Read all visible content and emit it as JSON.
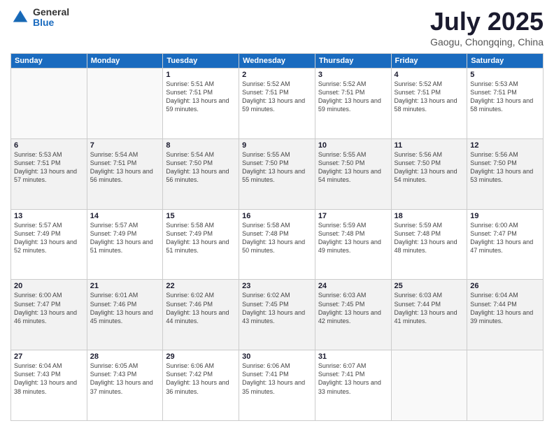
{
  "logo": {
    "general": "General",
    "blue": "Blue"
  },
  "header": {
    "month": "July 2025",
    "location": "Gaogu, Chongqing, China"
  },
  "weekdays": [
    "Sunday",
    "Monday",
    "Tuesday",
    "Wednesday",
    "Thursday",
    "Friday",
    "Saturday"
  ],
  "weeks": [
    [
      {
        "day": "",
        "info": ""
      },
      {
        "day": "",
        "info": ""
      },
      {
        "day": "1",
        "info": "Sunrise: 5:51 AM\nSunset: 7:51 PM\nDaylight: 13 hours and 59 minutes."
      },
      {
        "day": "2",
        "info": "Sunrise: 5:52 AM\nSunset: 7:51 PM\nDaylight: 13 hours and 59 minutes."
      },
      {
        "day": "3",
        "info": "Sunrise: 5:52 AM\nSunset: 7:51 PM\nDaylight: 13 hours and 59 minutes."
      },
      {
        "day": "4",
        "info": "Sunrise: 5:52 AM\nSunset: 7:51 PM\nDaylight: 13 hours and 58 minutes."
      },
      {
        "day": "5",
        "info": "Sunrise: 5:53 AM\nSunset: 7:51 PM\nDaylight: 13 hours and 58 minutes."
      }
    ],
    [
      {
        "day": "6",
        "info": "Sunrise: 5:53 AM\nSunset: 7:51 PM\nDaylight: 13 hours and 57 minutes."
      },
      {
        "day": "7",
        "info": "Sunrise: 5:54 AM\nSunset: 7:51 PM\nDaylight: 13 hours and 56 minutes."
      },
      {
        "day": "8",
        "info": "Sunrise: 5:54 AM\nSunset: 7:50 PM\nDaylight: 13 hours and 56 minutes."
      },
      {
        "day": "9",
        "info": "Sunrise: 5:55 AM\nSunset: 7:50 PM\nDaylight: 13 hours and 55 minutes."
      },
      {
        "day": "10",
        "info": "Sunrise: 5:55 AM\nSunset: 7:50 PM\nDaylight: 13 hours and 54 minutes."
      },
      {
        "day": "11",
        "info": "Sunrise: 5:56 AM\nSunset: 7:50 PM\nDaylight: 13 hours and 54 minutes."
      },
      {
        "day": "12",
        "info": "Sunrise: 5:56 AM\nSunset: 7:50 PM\nDaylight: 13 hours and 53 minutes."
      }
    ],
    [
      {
        "day": "13",
        "info": "Sunrise: 5:57 AM\nSunset: 7:49 PM\nDaylight: 13 hours and 52 minutes."
      },
      {
        "day": "14",
        "info": "Sunrise: 5:57 AM\nSunset: 7:49 PM\nDaylight: 13 hours and 51 minutes."
      },
      {
        "day": "15",
        "info": "Sunrise: 5:58 AM\nSunset: 7:49 PM\nDaylight: 13 hours and 51 minutes."
      },
      {
        "day": "16",
        "info": "Sunrise: 5:58 AM\nSunset: 7:48 PM\nDaylight: 13 hours and 50 minutes."
      },
      {
        "day": "17",
        "info": "Sunrise: 5:59 AM\nSunset: 7:48 PM\nDaylight: 13 hours and 49 minutes."
      },
      {
        "day": "18",
        "info": "Sunrise: 5:59 AM\nSunset: 7:48 PM\nDaylight: 13 hours and 48 minutes."
      },
      {
        "day": "19",
        "info": "Sunrise: 6:00 AM\nSunset: 7:47 PM\nDaylight: 13 hours and 47 minutes."
      }
    ],
    [
      {
        "day": "20",
        "info": "Sunrise: 6:00 AM\nSunset: 7:47 PM\nDaylight: 13 hours and 46 minutes."
      },
      {
        "day": "21",
        "info": "Sunrise: 6:01 AM\nSunset: 7:46 PM\nDaylight: 13 hours and 45 minutes."
      },
      {
        "day": "22",
        "info": "Sunrise: 6:02 AM\nSunset: 7:46 PM\nDaylight: 13 hours and 44 minutes."
      },
      {
        "day": "23",
        "info": "Sunrise: 6:02 AM\nSunset: 7:45 PM\nDaylight: 13 hours and 43 minutes."
      },
      {
        "day": "24",
        "info": "Sunrise: 6:03 AM\nSunset: 7:45 PM\nDaylight: 13 hours and 42 minutes."
      },
      {
        "day": "25",
        "info": "Sunrise: 6:03 AM\nSunset: 7:44 PM\nDaylight: 13 hours and 41 minutes."
      },
      {
        "day": "26",
        "info": "Sunrise: 6:04 AM\nSunset: 7:44 PM\nDaylight: 13 hours and 39 minutes."
      }
    ],
    [
      {
        "day": "27",
        "info": "Sunrise: 6:04 AM\nSunset: 7:43 PM\nDaylight: 13 hours and 38 minutes."
      },
      {
        "day": "28",
        "info": "Sunrise: 6:05 AM\nSunset: 7:43 PM\nDaylight: 13 hours and 37 minutes."
      },
      {
        "day": "29",
        "info": "Sunrise: 6:06 AM\nSunset: 7:42 PM\nDaylight: 13 hours and 36 minutes."
      },
      {
        "day": "30",
        "info": "Sunrise: 6:06 AM\nSunset: 7:41 PM\nDaylight: 13 hours and 35 minutes."
      },
      {
        "day": "31",
        "info": "Sunrise: 6:07 AM\nSunset: 7:41 PM\nDaylight: 13 hours and 33 minutes."
      },
      {
        "day": "",
        "info": ""
      },
      {
        "day": "",
        "info": ""
      }
    ]
  ]
}
